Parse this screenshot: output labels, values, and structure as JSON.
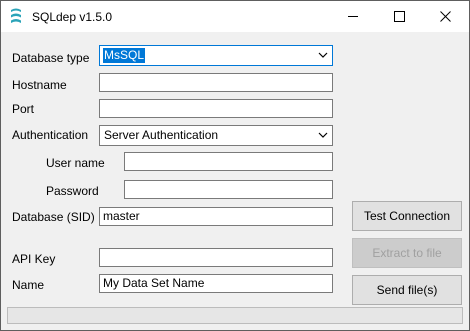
{
  "window": {
    "title": "SQLdep v1.5.0",
    "icon": "sqldep-logo-icon",
    "accent_color": "#0078d7"
  },
  "form": {
    "database_type_label": "Database type",
    "database_type_value": "MsSQL",
    "hostname_label": "Hostname",
    "hostname_value": "",
    "port_label": "Port",
    "port_value": "",
    "authentication_label": "Authentication",
    "authentication_value": "Server Authentication",
    "username_label": "User name",
    "username_value": "",
    "password_label": "Password",
    "password_value": "",
    "database_sid_label": "Database (SID)",
    "database_sid_value": "master",
    "api_key_label": "API Key",
    "api_key_value": "",
    "name_label": "Name",
    "name_value": "My Data Set Name"
  },
  "buttons": {
    "test_connection": "Test Connection",
    "extract_to_file": "Extract to file",
    "send_files": "Send file(s)"
  }
}
